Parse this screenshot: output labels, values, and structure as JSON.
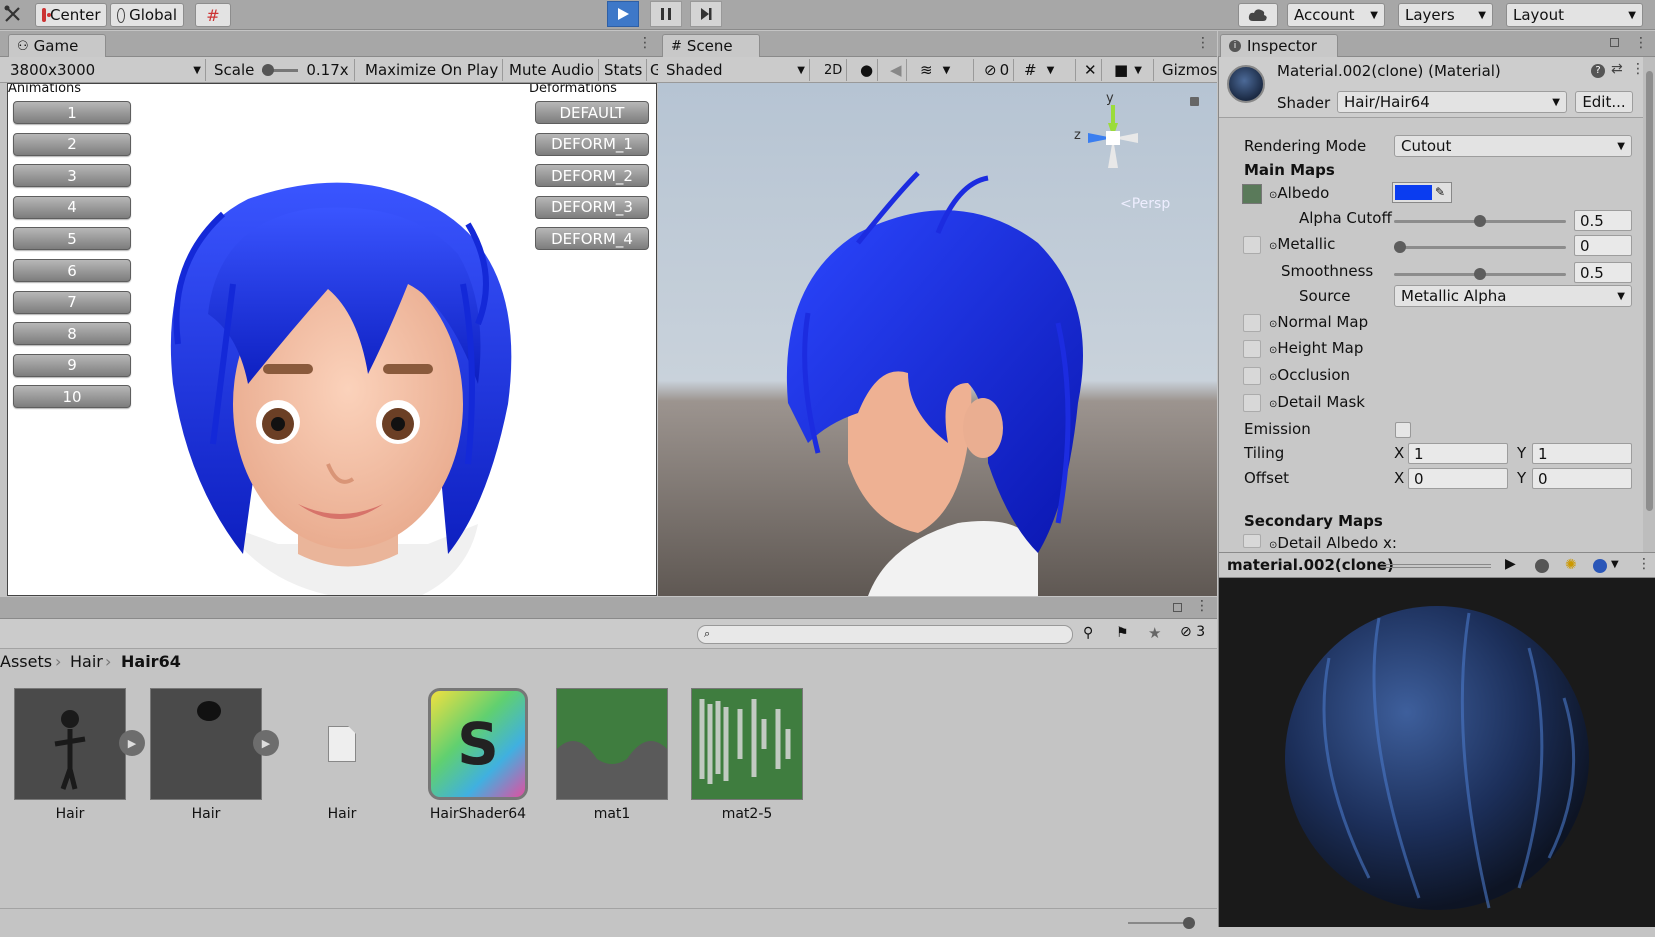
{
  "toolbar": {
    "pivot_label": "Center",
    "space_label": "Global",
    "account_label": "Account",
    "layers_label": "Layers",
    "layout_label": "Layout"
  },
  "game": {
    "tab_label": "Game",
    "resolution": "3800x3000",
    "scale_label": "Scale",
    "scale_value": "0.17x",
    "maximize_label": "Maximize On Play",
    "mute_label": "Mute Audio",
    "stats_label": "Stats",
    "gizmos_cut": "G",
    "animations_label": "Animations",
    "deformations_label": "Deformations",
    "animation_buttons": [
      "1",
      "2",
      "3",
      "4",
      "5",
      "6",
      "7",
      "8",
      "9",
      "10"
    ],
    "deform_buttons": [
      "DEFAULT",
      "DEFORM_1",
      "DEFORM_2",
      "DEFORM_3",
      "DEFORM_4"
    ]
  },
  "scene": {
    "tab_label": "Scene",
    "shading_mode": "Shaded",
    "mode_2d": "2D",
    "hidden_count": "0",
    "gizmos_label": "Gizmos",
    "axis_y": "y",
    "axis_z": "z",
    "persp_label": "<Persp"
  },
  "inspector": {
    "tab_label": "Inspector",
    "material_title": "Material.002(clone) (Material)",
    "shader_label": "Shader",
    "shader_value": "Hair/Hair64",
    "edit_label": "Edit...",
    "rendering_mode_label": "Rendering Mode",
    "rendering_mode_value": "Cutout",
    "main_maps_label": "Main Maps",
    "albedo_label": "Albedo",
    "albedo_color": "#0a3cf0",
    "alpha_cutoff_label": "Alpha Cutoff",
    "alpha_cutoff_value": "0.5",
    "alpha_cutoff_fraction": 0.5,
    "metallic_label": "Metallic",
    "metallic_value": "0",
    "metallic_fraction": 0,
    "smoothness_label": "Smoothness",
    "smoothness_value": "0.5",
    "smoothness_fraction": 0.5,
    "source_label": "Source",
    "source_value": "Metallic Alpha",
    "normal_map_label": "Normal Map",
    "height_map_label": "Height Map",
    "occlusion_label": "Occlusion",
    "detail_mask_label": "Detail Mask",
    "emission_label": "Emission",
    "tiling_label": "Tiling",
    "tiling_x": "1",
    "tiling_y": "1",
    "offset_label": "Offset",
    "offset_x": "0",
    "offset_y": "0",
    "x_label": "X",
    "y_label": "Y",
    "secondary_maps_label": "Secondary Maps",
    "detail_albedo_label": "Detail Albedo x:",
    "preview_title": "material.002(clone)"
  },
  "project": {
    "search_placeholder": "",
    "hidden_count": "3",
    "breadcrumb": [
      "Assets",
      "Hair",
      "Hair64"
    ],
    "assets": [
      {
        "name": "Hair"
      },
      {
        "name": "Hair"
      },
      {
        "name": "Hair"
      },
      {
        "name": "HairShader64"
      },
      {
        "name": "mat1"
      },
      {
        "name": "mat2-5"
      }
    ],
    "shader_letter": "S"
  }
}
